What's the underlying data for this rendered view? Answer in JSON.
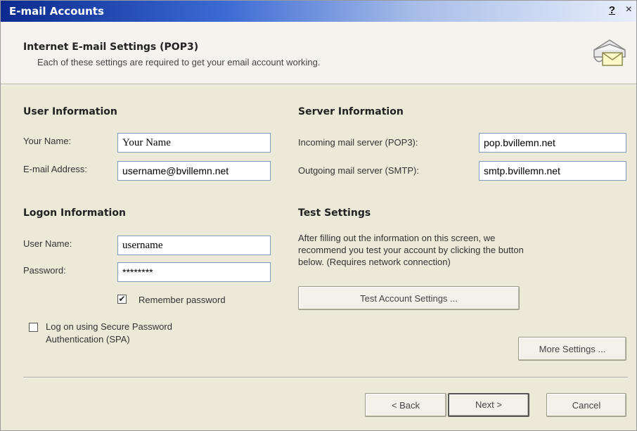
{
  "window": {
    "title": "E-mail Accounts",
    "help_glyph": "?",
    "close_glyph": "×"
  },
  "header": {
    "title": "Internet E-mail Settings (POP3)",
    "subtitle": "Each of these settings are required to get your email account working."
  },
  "user_info": {
    "heading": "User Information",
    "name_label": "Your Name:",
    "name_value": "Your Name",
    "email_label": "E-mail Address:",
    "email_value": "username@bvillemn.net"
  },
  "server_info": {
    "heading": "Server Information",
    "incoming_label": "Incoming mail server (POP3):",
    "incoming_value": "pop.bvillemn.net",
    "outgoing_label": "Outgoing mail server (SMTP):",
    "outgoing_value": "smtp.bvillemn.net"
  },
  "logon_info": {
    "heading": "Logon Information",
    "username_label": "User Name:",
    "username_value": "username",
    "password_label": "Password:",
    "password_value": "********",
    "remember_label": "Remember password",
    "remember_checked": true,
    "spa_label_line1": "Log on using Secure Password",
    "spa_label_line2": "Authentication (SPA)",
    "spa_checked": false
  },
  "test_settings": {
    "heading": "Test Settings",
    "desc_line1": "After filling out the information on this screen, we",
    "desc_line2": "recommend you test your account by clicking the button",
    "desc_line3": "below. (Requires network connection)",
    "test_button": "Test Account Settings ..."
  },
  "buttons": {
    "more_settings": "More Settings ...",
    "back": "< Back",
    "next": "Next >",
    "cancel": "Cancel"
  }
}
